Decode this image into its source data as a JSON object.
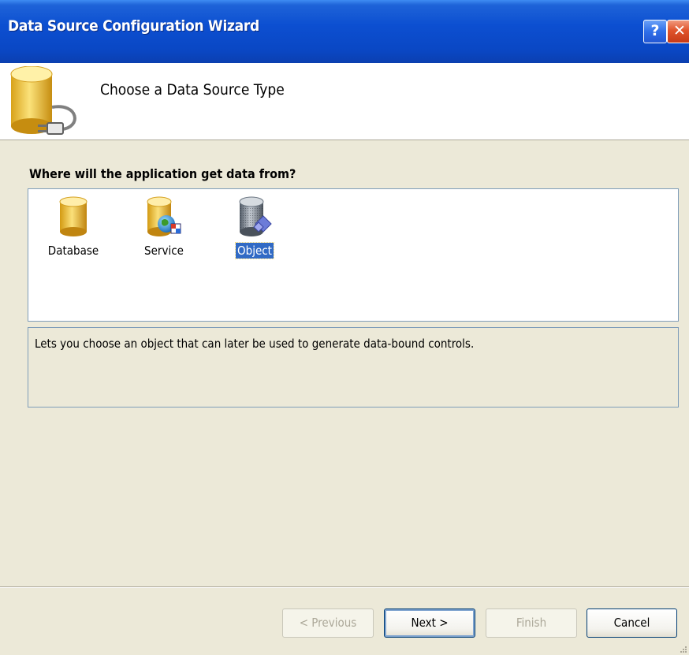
{
  "window": {
    "title": "Data Source Configuration Wizard",
    "help_glyph": "?",
    "close_glyph": "✕"
  },
  "header": {
    "title": "Choose a Data Source Type",
    "icon": "database-plug-icon"
  },
  "body": {
    "prompt": "Where will the application get data from?",
    "data_sources": [
      {
        "label": "Database",
        "icon": "database-icon",
        "selected": false
      },
      {
        "label": "Service",
        "icon": "service-icon",
        "selected": false
      },
      {
        "label": "Object",
        "icon": "object-icon",
        "selected": true
      }
    ],
    "description": "Lets you choose an object that can later be used to generate data-bound controls."
  },
  "buttons": {
    "previous": "< Previous",
    "next": "Next >",
    "finish": "Finish",
    "cancel": "Cancel"
  },
  "colors": {
    "title_bar": "#0a47c4",
    "selection": "#316ac5",
    "dialog_background": "#ece9d8",
    "close_button": "#e0542b"
  }
}
